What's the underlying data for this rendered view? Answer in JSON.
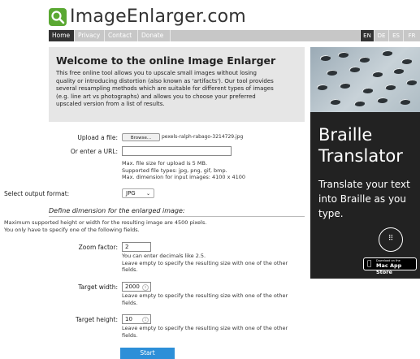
{
  "site": {
    "title": "ImageEnlarger.com"
  },
  "nav": {
    "items": [
      "Home",
      "Privacy",
      "Contact",
      "Donate"
    ],
    "languages": [
      "EN",
      "DE",
      "ES",
      "FR"
    ]
  },
  "welcome": {
    "heading": "Welcome to the online Image Enlarger",
    "lines": [
      "This free online tool allows you to upscale small images without losing",
      "quality or introducing distortion (also known as 'artifacts'). Our tool provides",
      "several resampling methods which are suitable for different types of images",
      "(e.g. line art vs photographs) and allows you to choose your preferred",
      "upscaled version from a list of results."
    ]
  },
  "form": {
    "upload_label": "Upload a file:",
    "browse_label": "Browse...",
    "file_name": "pexels-ralph-rabago-3214729.jpg",
    "url_label": "Or enter a URL:",
    "url_value": "",
    "limits": [
      "Max. file size for upload is 5 MB.",
      "Supported file types: jpg, png, gif, bmp.",
      "Max. dimension for input images: 4100 x 4100"
    ],
    "format_label": "Select output format:",
    "format_value": "JPG",
    "dimension_title": "Define dimension for the enlarged image:",
    "dimension_notes": [
      "Maximum supported height or width for the resulting image are 4500 pixels.",
      "You only have to specify one of the following fields."
    ],
    "zoom_label": "Zoom factor:",
    "zoom_value": "2",
    "zoom_hint": [
      "You can enter decimals like 2.5.",
      "Leave empty to specify the resulting size with one of the other",
      "fields."
    ],
    "width_label": "Target width:",
    "width_value": "2000",
    "width_hint": [
      "Leave empty to specify the resulting size with one of the other",
      "fields."
    ],
    "height_label": "Target height:",
    "height_value": "10",
    "height_hint": [
      "Leave empty to specify the resulting size with one of the other",
      "fields."
    ],
    "start_label": "Start"
  },
  "ad": {
    "title_line1": "Braille",
    "title_line2": "Translator",
    "subtitle_lines": [
      "Translate your text",
      "into Braille as you",
      "type."
    ],
    "badge_small": "Download on the",
    "badge_big": "Mac App Store",
    "icon_glyph": "⠿"
  },
  "colors": {
    "nav_bg": "#c7c7c7",
    "nav_active": "#333333",
    "start_button": "#2d8fd8",
    "ad_bg": "#222222"
  }
}
